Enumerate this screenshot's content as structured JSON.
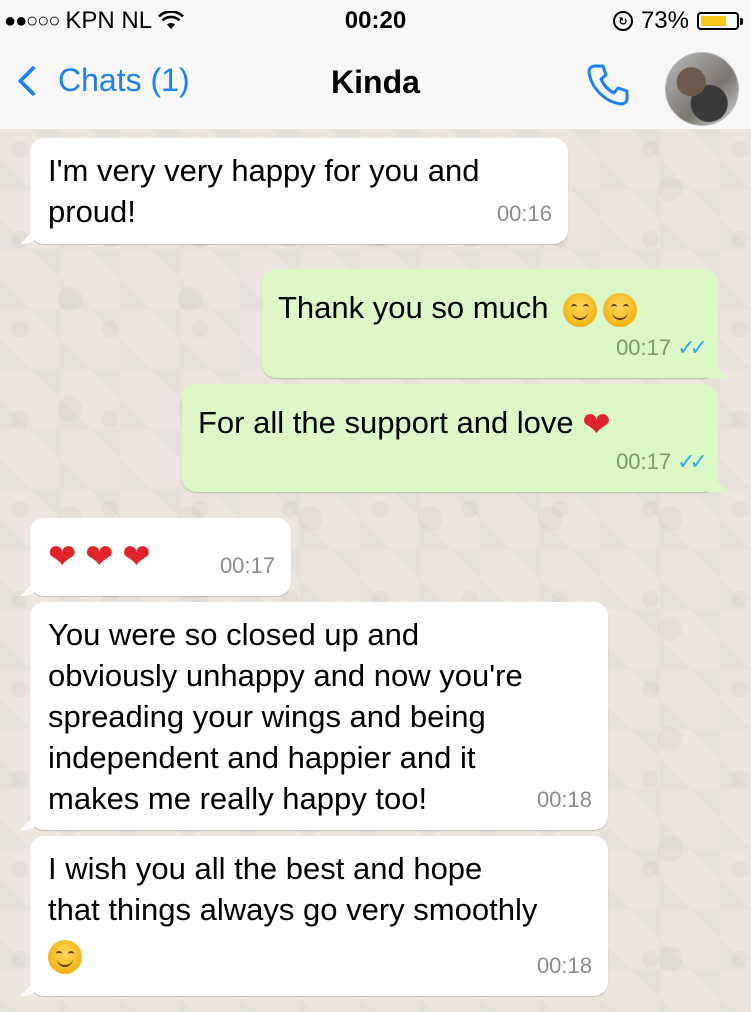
{
  "status_bar": {
    "signal": "●●○○○",
    "carrier": "KPN NL",
    "wifi_icon": "wifi-icon",
    "time": "00:20",
    "battery_percent": "73%",
    "battery_level": 0.73,
    "battery_color": "#f5c518"
  },
  "navbar": {
    "back_label": "Chats (1)",
    "title": "Kinda",
    "accent_color": "#1b7ff5"
  },
  "messages": [
    {
      "direction": "in",
      "text": "I'm very very happy for you and\nproud!",
      "time": "00:16"
    },
    {
      "direction": "out",
      "text": "Thank you so much",
      "time": "00:17",
      "emojis": [
        "smiling-face",
        "smiling-face"
      ],
      "read": true
    },
    {
      "direction": "out",
      "text": "For all the support and love",
      "time": "00:17",
      "emojis": [
        "red-heart"
      ],
      "read": true
    },
    {
      "direction": "in",
      "text": "",
      "time": "00:17",
      "emojis": [
        "red-heart",
        "red-heart",
        "red-heart"
      ]
    },
    {
      "direction": "in",
      "text": "You were so closed up and\nobviously unhappy and now you're\nspreading your wings and being\nindependent and happier and it\nmakes me really happy too!",
      "time": "00:18"
    },
    {
      "direction": "in",
      "text": "I wish you all the best and hope\nthat things always go very smoothly",
      "time": "00:18",
      "emojis": [
        "smiling-face"
      ]
    }
  ],
  "colors": {
    "incoming_bubble": "#ffffff",
    "outgoing_bubble": "#dcf8c6",
    "read_ticks": "#34aaf0"
  }
}
